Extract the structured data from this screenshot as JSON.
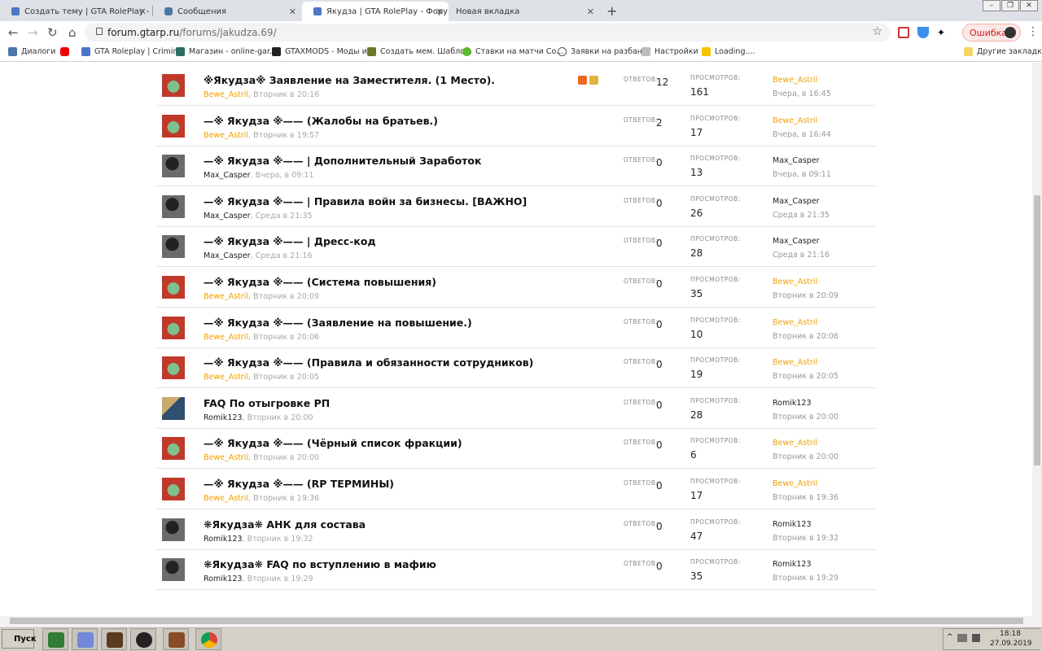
{
  "tabs": [
    {
      "title": "Создать тему | GTA RolePlay - Фор"
    },
    {
      "title": "Сообщения"
    },
    {
      "title": "Якудза | GTA RolePlay - Форум"
    },
    {
      "title": "Новая вкладка"
    }
  ],
  "address_bar": {
    "domain": "forum.gtarp.ru",
    "path": "/forums/jakudza.69/"
  },
  "error_chip": "Ошибка",
  "bookmarks": [
    {
      "label": "Диалоги"
    },
    {
      "label": ""
    },
    {
      "label": "GTA Roleplay | Crimin..."
    },
    {
      "label": "Магазин - online-gar..."
    },
    {
      "label": "GTAXMODS - Моды и..."
    },
    {
      "label": "Создать мем. Шабло..."
    },
    {
      "label": "Ставки на матчи Co..."
    },
    {
      "label": "Заявки на разбан |"
    },
    {
      "label": "Настройки"
    },
    {
      "label": "Loading...."
    }
  ],
  "other_bookmarks": "Другие закладки",
  "labels": {
    "replies": "ОТВЕТОВ:",
    "views": "ПРОСМОТРОВ:"
  },
  "threads": [
    {
      "title": "※Якудза※ Заявление на Заместителя. (1 Место).",
      "author": "Bewe_Astril",
      "date": "Вторник в 20:16",
      "replies": "12",
      "views": "161",
      "last_user": "Bewe_Astril",
      "last_date": "Вчера, в 16:45",
      "avatar": "green"
    },
    {
      "title": "—※ Якудза ※—— (Жалобы на братьев.)",
      "author": "Bewe_Astril",
      "date": "Вторник в 19:57",
      "replies": "2",
      "views": "17",
      "last_user": "Bewe_Astril",
      "last_date": "Вчера, в 16:44",
      "avatar": "green"
    },
    {
      "title": "—※ Якудза ※—— | Дополнительный Заработок",
      "author": "Max_Casper",
      "date": "Вчера, в 09:11",
      "replies": "0",
      "views": "13",
      "last_user": "Max_Casper",
      "last_date": "Вчера, в 09:11",
      "avatar": "dark"
    },
    {
      "title": "—※ Якудза ※—— | Правила войн за бизнесы. [ВАЖНО]",
      "author": "Max_Casper",
      "date": "Среда в 21:35",
      "replies": "0",
      "views": "26",
      "last_user": "Max_Casper",
      "last_date": "Среда в 21:35",
      "avatar": "dark"
    },
    {
      "title": "—※ Якудза ※—— | Дресс-код",
      "author": "Max_Casper",
      "date": "Среда в 21:16",
      "replies": "0",
      "views": "28",
      "last_user": "Max_Casper",
      "last_date": "Среда в 21:16",
      "avatar": "dark"
    },
    {
      "title": "—※ Якудза ※—— (Система повышения)",
      "author": "Bewe_Astril",
      "date": "Вторник в 20:09",
      "replies": "0",
      "views": "35",
      "last_user": "Bewe_Astril",
      "last_date": "Вторник в 20:09",
      "avatar": "green"
    },
    {
      "title": "—※ Якудза ※—— (Заявление на повышение.)",
      "author": "Bewe_Astril",
      "date": "Вторник в 20:06",
      "replies": "0",
      "views": "10",
      "last_user": "Bewe_Astril",
      "last_date": "Вторник в 20:06",
      "avatar": "green"
    },
    {
      "title": "—※ Якудза ※—— (Правила и обязанности сотрудников)",
      "author": "Bewe_Astril",
      "date": "Вторник в 20:05",
      "replies": "0",
      "views": "19",
      "last_user": "Bewe_Astril",
      "last_date": "Вторник в 20:05",
      "avatar": "green"
    },
    {
      "title": "FAQ По отыгровке РП",
      "author": "Romik123",
      "date": "Вторник в 20:00",
      "replies": "0",
      "views": "28",
      "last_user": "Romik123",
      "last_date": "Вторник в 20:00",
      "avatar": "blue"
    },
    {
      "title": "—※ Якудза ※—— (Чёрный список фракции)",
      "author": "Bewe_Astril",
      "date": "Вторник в 20:00",
      "replies": "0",
      "views": "6",
      "last_user": "Bewe_Astril",
      "last_date": "Вторник в 20:00",
      "avatar": "green"
    },
    {
      "title": "—※ Якудза ※—— (RP ТЕРМИНЫ)",
      "author": "Bewe_Astril",
      "date": "Вторник в 19:36",
      "replies": "0",
      "views": "17",
      "last_user": "Bewe_Astril",
      "last_date": "Вторник в 19:36",
      "avatar": "green"
    },
    {
      "title": "❋Якудза❋ АНК для состава",
      "author": "Romik123",
      "date": "Вторник в 19:32",
      "replies": "0",
      "views": "47",
      "last_user": "Romik123",
      "last_date": "Вторник в 19:32",
      "avatar": "dark"
    },
    {
      "title": "❋Якудза❋ FAQ по вступлению в мафию",
      "author": "Romik123",
      "date": "Вторник в 19:29",
      "replies": "0",
      "views": "35",
      "last_user": "Romik123",
      "last_date": "Вторник в 19:29",
      "avatar": "dark"
    }
  ],
  "taskbar": {
    "start": "Пуск",
    "time": "18:18",
    "date": "27.09.2019"
  }
}
